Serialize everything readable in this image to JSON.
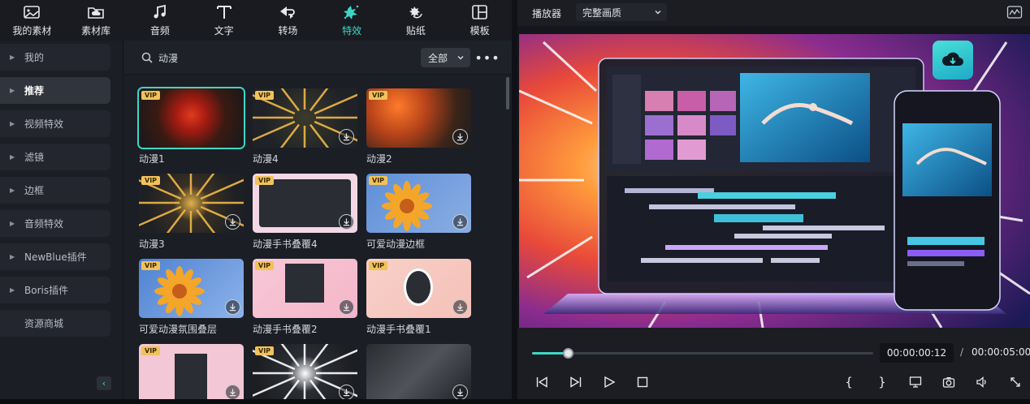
{
  "toolbar": {
    "items": [
      {
        "label": "我的素材",
        "icon": "image-icon"
      },
      {
        "label": "素材库",
        "icon": "cloud-folder-icon"
      },
      {
        "label": "音频",
        "icon": "music-note-icon"
      },
      {
        "label": "文字",
        "icon": "text-icon"
      },
      {
        "label": "转场",
        "icon": "transition-icon"
      },
      {
        "label": "特效",
        "icon": "sparkle-effect-icon",
        "active": true
      },
      {
        "label": "贴纸",
        "icon": "sticker-icon"
      },
      {
        "label": "模板",
        "icon": "template-icon"
      }
    ]
  },
  "sidebar": {
    "items": [
      {
        "label": "我的"
      },
      {
        "label": "推荐",
        "active": true
      },
      {
        "label": "视频特效"
      },
      {
        "label": "滤镜"
      },
      {
        "label": "边框"
      },
      {
        "label": "音频特效"
      },
      {
        "label": "NewBlue插件"
      },
      {
        "label": "Boris插件"
      },
      {
        "label": "资源商城"
      }
    ],
    "collapse_glyph": "‹"
  },
  "search": {
    "value": "动漫",
    "filter_label": "全部",
    "more_glyph": "•••"
  },
  "cards": [
    {
      "label": "动漫1",
      "vip": "VIP",
      "download": false
    },
    {
      "label": "动漫4",
      "vip": "VIP",
      "download": true
    },
    {
      "label": "动漫2",
      "vip": "VIP",
      "download": true
    },
    {
      "label": "动漫3",
      "vip": "VIP",
      "download": true
    },
    {
      "label": "动漫手书叠覆4",
      "vip": "VIP",
      "download": true
    },
    {
      "label": "可爱动漫边框",
      "vip": "VIP",
      "download": true
    },
    {
      "label": "可爱动漫氛围叠层",
      "vip": "VIP",
      "download": true
    },
    {
      "label": "动漫手书叠覆2",
      "vip": "VIP",
      "download": true
    },
    {
      "label": "动漫手书叠覆1",
      "vip": "VIP",
      "download": true
    },
    {
      "label": "",
      "vip": "VIP",
      "download": true
    },
    {
      "label": "",
      "vip": "VIP",
      "download": true
    },
    {
      "label": "",
      "vip": "",
      "download": true
    }
  ],
  "player": {
    "title": "播放器",
    "quality": "完整画质",
    "current_time": "00:00:00:12",
    "separator": "/",
    "total_time": "00:00:05:00",
    "progress": 0.105
  },
  "controls": {
    "brace_open": "{",
    "brace_close": "}"
  },
  "colors": {
    "accent": "#3fd7c4",
    "vip_badge": "#f0c25a",
    "panel_bg": "#1b1e25"
  }
}
